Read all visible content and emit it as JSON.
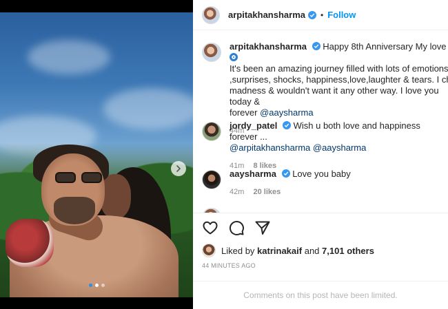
{
  "post": {
    "author": "arpitakhansharma",
    "follow_label": "Follow",
    "separator": "•"
  },
  "photo": {
    "carousel_dots": 3,
    "active_dot": 0
  },
  "comments": [
    {
      "user": "arpitakhansharma",
      "text_lines": [
        "Happy 8th Anniversary My love",
        "It's been an amazing journey filled with lots of emotions",
        ",surprises, shocks, happiness,love,laughter & tears. I cherish our",
        "madness & wouldn't want it any other way. I love you today &",
        "forever"
      ],
      "mention": "@aaysharma",
      "time": "44m"
    },
    {
      "user": "jordy_patel",
      "text": "Wish u both love and happiness forever ...",
      "mentions": "@arpitakhansharma @aaysharma",
      "time": "41m",
      "likes": "8 likes"
    },
    {
      "user": "aaysharma",
      "text": "Love you baby",
      "time": "42m",
      "likes": "20 likes"
    }
  ],
  "likes": {
    "prefix": "Liked by",
    "user": "katrinakaif",
    "and": "and",
    "count": "7,101 others"
  },
  "timestamp": "44 MINUTES AGO",
  "comments_limited": "Comments on this post have been limited.",
  "icons": [
    "heart-icon",
    "comment-icon",
    "share-icon",
    "verified-icon",
    "chevron-right-icon"
  ],
  "colors": {
    "accent": "#0095f6",
    "verified": "#3897f0",
    "muted": "#8e8e8e"
  }
}
